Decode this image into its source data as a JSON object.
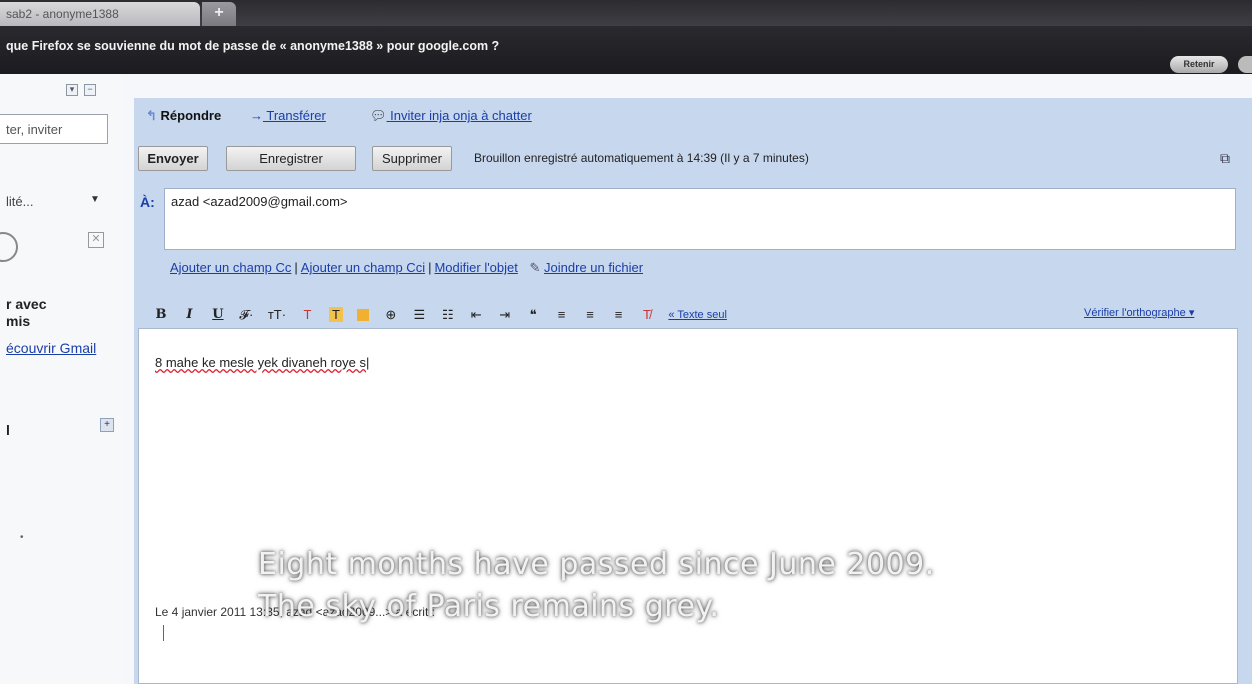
{
  "browser": {
    "tab_title": "sab2 - anonyme1388",
    "new_tab": "+",
    "password_prompt": "que Firefox se souvienne du mot de passe de « anonyme1388 » pour google.com ?",
    "remember_button": "Retenir"
  },
  "sidebar": {
    "search_placeholder": "ter, inviter",
    "status_label": "lité...",
    "status_arrow": "▼",
    "close_x": "✕",
    "chat_text_line1": "r avec",
    "chat_text_line2": "mis",
    "discover_link": "écouvrir Gmail",
    "contact_label": "l",
    "minimize": "−",
    "plus": "+"
  },
  "thread_actions": {
    "reply": "Répondre",
    "forward": "Transférer",
    "invite_chat": "Inviter inja onja à chatter"
  },
  "compose": {
    "send": "Envoyer",
    "save": "Enregistrer",
    "delete": "Supprimer",
    "draft_status": "Brouillon enregistré automatiquement à 14:39 (Il y a 7 minutes)",
    "to_label": "À:",
    "to_value": "azad <azad2009@gmail.com>",
    "add_cc": "Ajouter un champ Cc",
    "add_bcc": "Ajouter un champ Cci",
    "edit_subject": "Modifier l'objet",
    "attach": "Joindre un fichier",
    "plain_text": "« Texte seul",
    "spell_check": "Vérifier l'orthographe ▾",
    "body_text": "8 mahe ke mesle yek divaneh roye s",
    "signoff": "Le 4 janvier 2011 13:35, azad <azad2009...> a écrit :"
  },
  "toolbar": {
    "bold": "B",
    "italic": "I",
    "underline": "U",
    "font": "𝓕·",
    "size": "тT·",
    "textcolor": "T",
    "bgcolor": "T",
    "link": "⊕",
    "numbered": "☰",
    "bulleted": "☷",
    "outdent": "⇤",
    "indent": "⇥",
    "quote": "❝",
    "align_left": "≡",
    "align_center": "≡",
    "align_right": "≡",
    "clear": "T̸"
  },
  "subtitles": {
    "line1": "Eight months have passed since June 2009.",
    "line2": "The sky of Paris remains grey."
  }
}
